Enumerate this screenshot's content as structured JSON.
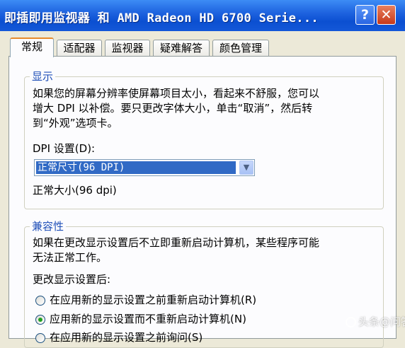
{
  "window": {
    "title": "即插即用监视器 和 AMD Radeon HD 6700 Serie...",
    "help_label": "?",
    "close_label": "✕"
  },
  "tabs": [
    {
      "label": "常规",
      "active": true
    },
    {
      "label": "适配器",
      "active": false
    },
    {
      "label": "监视器",
      "active": false
    },
    {
      "label": "疑难解答",
      "active": false
    },
    {
      "label": "颜色管理",
      "active": false
    }
  ],
  "display_group": {
    "legend": "显示",
    "description_line1": "如果您的屏幕分辨率使屏幕项目太小，看起来不舒服，您可以",
    "description_line2": "增大 DPI 以补偿。要只更改字体大小，单击“取消”，然后转",
    "description_line3": "到“外观”选项卡。",
    "dpi_label": "DPI 设置(D):",
    "dpi_selected": "正常尺寸(96 DPI)",
    "dpi_note": "正常大小(96 dpi)"
  },
  "compat_group": {
    "legend": "兼容性",
    "description_line1": "如果在更改显示设置后不立即重新启动计算机，某些程序可能",
    "description_line2": "无法正常工作。",
    "after_change_label": "更改显示设置后:",
    "options": [
      {
        "label": "在应用新的显示设置之前重新启动计算机(R)",
        "selected": false
      },
      {
        "label": "应用新的显示设置而不重新启动计算机(N)",
        "selected": true
      },
      {
        "label": "在应用新的显示设置之前询问(S)",
        "selected": false
      }
    ]
  },
  "watermark": {
    "text": "头条@问答",
    "icon": "toutiao-logo-icon"
  },
  "colors": {
    "titlebar": "#0b4fd1",
    "legend": "#1f4fb8",
    "selection": "#316ac5",
    "tab_highlight": "#e68b2c"
  }
}
